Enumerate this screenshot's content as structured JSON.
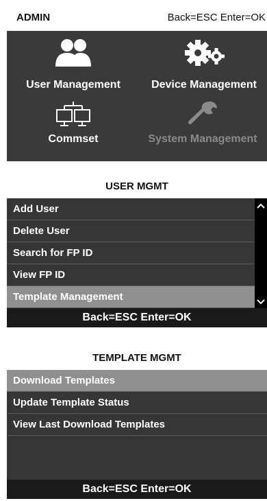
{
  "admin": {
    "title": "ADMIN",
    "hint": "Back=ESC Enter=OK",
    "tiles": [
      {
        "label": "User Management",
        "icon": "users-icon",
        "enabled": true
      },
      {
        "label": "Device Management",
        "icon": "gears-icon",
        "enabled": true
      },
      {
        "label": "Commset",
        "icon": "network-icon",
        "enabled": true
      },
      {
        "label": "System Management",
        "icon": "wrench-icon",
        "enabled": false
      }
    ]
  },
  "user_mgmt": {
    "title": "USER MGMT",
    "items": [
      "Add User",
      "Delete User",
      "Search for FP ID",
      "View FP ID",
      "Template Management"
    ],
    "selected_index": 4,
    "footer": "Back=ESC Enter=OK"
  },
  "template_mgmt": {
    "title": "TEMPLATE MGMT",
    "items": [
      "Download Templates",
      "Update Template Status",
      "View Last Download Templates"
    ],
    "selected_index": 0,
    "footer": "Back=ESC Enter=OK"
  },
  "colors": {
    "panel_bg": "#3a3a3a",
    "selected_bg": "#8f8f8f",
    "footer_bg": "#1a1a1a",
    "disabled_text": "#8a8a8a"
  }
}
